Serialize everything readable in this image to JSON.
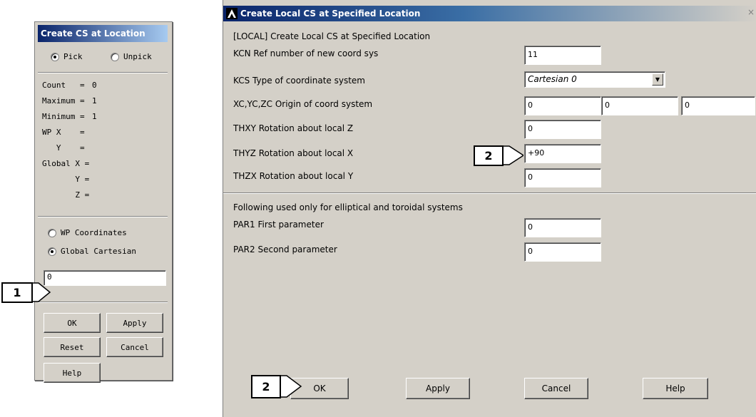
{
  "pick_dialog": {
    "title": "Create CS at Location",
    "pick_label": "Pick",
    "unpick_label": "Unpick",
    "info": [
      {
        "label": "Count   =",
        "value": "0"
      },
      {
        "label": "Maximum =",
        "value": "1"
      },
      {
        "label": "Minimum =",
        "value": "1"
      },
      {
        "label": "WP X    =",
        "value": ""
      },
      {
        "label": "   Y    =",
        "value": ""
      },
      {
        "label": "Global X =",
        "value": ""
      },
      {
        "label": "       Y =",
        "value": ""
      },
      {
        "label": "       Z =",
        "value": ""
      }
    ],
    "wp_coordinates_label": "WP Coordinates",
    "global_cartesian_label": "Global Cartesian",
    "input_value": "0",
    "ok_label": "OK",
    "apply_label": "Apply",
    "reset_label": "Reset",
    "cancel_label": "Cancel",
    "help_label": "Help"
  },
  "main_dialog": {
    "title": "Create Local CS at Specified Location",
    "close_glyph": "×",
    "header": "[LOCAL]  Create Local CS at Specified Location",
    "kcn_label": "KCN  Ref number of new coord sys",
    "kcn_value": "11",
    "kcs_label": "KCS  Type of coordinate system",
    "kcs_value": "Cartesian    0",
    "origin_label": "XC,YC,ZC  Origin of coord system",
    "xc_value": "0",
    "yc_value": "0",
    "zc_value": "0",
    "thxy_label": "THXY  Rotation about local Z",
    "thxy_value": "0",
    "thyz_label": "THYZ  Rotation about local X",
    "thyz_value": "+90",
    "thzx_label": "THZX  Rotation about local Y",
    "thzx_value": "0",
    "elliptical_note": "Following used only for elliptical and toroidal systems",
    "par1_label": "PAR1  First parameter",
    "par1_value": "0",
    "par2_label": "PAR2  Second parameter",
    "par2_value": "0",
    "ok_label": "OK",
    "apply_label": "Apply",
    "cancel_label": "Cancel",
    "help_label": "Help"
  },
  "callouts": {
    "one": "1",
    "two_thyz": "2",
    "two_ok": "2"
  }
}
